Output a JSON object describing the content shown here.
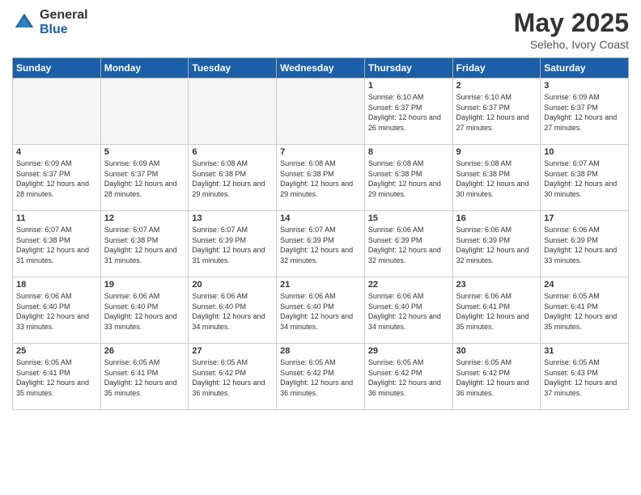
{
  "header": {
    "logo_general": "General",
    "logo_blue": "Blue",
    "title": "May 2025",
    "location": "Seleho, Ivory Coast"
  },
  "weekdays": [
    "Sunday",
    "Monday",
    "Tuesday",
    "Wednesday",
    "Thursday",
    "Friday",
    "Saturday"
  ],
  "weeks": [
    [
      {
        "day": "",
        "empty": true
      },
      {
        "day": "",
        "empty": true
      },
      {
        "day": "",
        "empty": true
      },
      {
        "day": "",
        "empty": true
      },
      {
        "day": "1",
        "sunrise": "6:10 AM",
        "sunset": "6:37 PM",
        "daylight": "12 hours and 26 minutes."
      },
      {
        "day": "2",
        "sunrise": "6:10 AM",
        "sunset": "6:37 PM",
        "daylight": "12 hours and 27 minutes."
      },
      {
        "day": "3",
        "sunrise": "6:09 AM",
        "sunset": "6:37 PM",
        "daylight": "12 hours and 27 minutes."
      }
    ],
    [
      {
        "day": "4",
        "sunrise": "6:09 AM",
        "sunset": "6:37 PM",
        "daylight": "12 hours and 28 minutes."
      },
      {
        "day": "5",
        "sunrise": "6:09 AM",
        "sunset": "6:37 PM",
        "daylight": "12 hours and 28 minutes."
      },
      {
        "day": "6",
        "sunrise": "6:08 AM",
        "sunset": "6:38 PM",
        "daylight": "12 hours and 29 minutes."
      },
      {
        "day": "7",
        "sunrise": "6:08 AM",
        "sunset": "6:38 PM",
        "daylight": "12 hours and 29 minutes."
      },
      {
        "day": "8",
        "sunrise": "6:08 AM",
        "sunset": "6:38 PM",
        "daylight": "12 hours and 29 minutes."
      },
      {
        "day": "9",
        "sunrise": "6:08 AM",
        "sunset": "6:38 PM",
        "daylight": "12 hours and 30 minutes."
      },
      {
        "day": "10",
        "sunrise": "6:07 AM",
        "sunset": "6:38 PM",
        "daylight": "12 hours and 30 minutes."
      }
    ],
    [
      {
        "day": "11",
        "sunrise": "6:07 AM",
        "sunset": "6:38 PM",
        "daylight": "12 hours and 31 minutes."
      },
      {
        "day": "12",
        "sunrise": "6:07 AM",
        "sunset": "6:38 PM",
        "daylight": "12 hours and 31 minutes."
      },
      {
        "day": "13",
        "sunrise": "6:07 AM",
        "sunset": "6:39 PM",
        "daylight": "12 hours and 31 minutes."
      },
      {
        "day": "14",
        "sunrise": "6:07 AM",
        "sunset": "6:39 PM",
        "daylight": "12 hours and 32 minutes."
      },
      {
        "day": "15",
        "sunrise": "6:06 AM",
        "sunset": "6:39 PM",
        "daylight": "12 hours and 32 minutes."
      },
      {
        "day": "16",
        "sunrise": "6:06 AM",
        "sunset": "6:39 PM",
        "daylight": "12 hours and 32 minutes."
      },
      {
        "day": "17",
        "sunrise": "6:06 AM",
        "sunset": "6:39 PM",
        "daylight": "12 hours and 33 minutes."
      }
    ],
    [
      {
        "day": "18",
        "sunrise": "6:06 AM",
        "sunset": "6:40 PM",
        "daylight": "12 hours and 33 minutes."
      },
      {
        "day": "19",
        "sunrise": "6:06 AM",
        "sunset": "6:40 PM",
        "daylight": "12 hours and 33 minutes."
      },
      {
        "day": "20",
        "sunrise": "6:06 AM",
        "sunset": "6:40 PM",
        "daylight": "12 hours and 34 minutes."
      },
      {
        "day": "21",
        "sunrise": "6:06 AM",
        "sunset": "6:40 PM",
        "daylight": "12 hours and 34 minutes."
      },
      {
        "day": "22",
        "sunrise": "6:06 AM",
        "sunset": "6:40 PM",
        "daylight": "12 hours and 34 minutes."
      },
      {
        "day": "23",
        "sunrise": "6:06 AM",
        "sunset": "6:41 PM",
        "daylight": "12 hours and 35 minutes."
      },
      {
        "day": "24",
        "sunrise": "6:05 AM",
        "sunset": "6:41 PM",
        "daylight": "12 hours and 35 minutes."
      }
    ],
    [
      {
        "day": "25",
        "sunrise": "6:05 AM",
        "sunset": "6:41 PM",
        "daylight": "12 hours and 35 minutes."
      },
      {
        "day": "26",
        "sunrise": "6:05 AM",
        "sunset": "6:41 PM",
        "daylight": "12 hours and 35 minutes."
      },
      {
        "day": "27",
        "sunrise": "6:05 AM",
        "sunset": "6:42 PM",
        "daylight": "12 hours and 36 minutes."
      },
      {
        "day": "28",
        "sunrise": "6:05 AM",
        "sunset": "6:42 PM",
        "daylight": "12 hours and 36 minutes."
      },
      {
        "day": "29",
        "sunrise": "6:05 AM",
        "sunset": "6:42 PM",
        "daylight": "12 hours and 36 minutes."
      },
      {
        "day": "30",
        "sunrise": "6:05 AM",
        "sunset": "6:42 PM",
        "daylight": "12 hours and 36 minutes."
      },
      {
        "day": "31",
        "sunrise": "6:05 AM",
        "sunset": "6:43 PM",
        "daylight": "12 hours and 37 minutes."
      }
    ]
  ]
}
